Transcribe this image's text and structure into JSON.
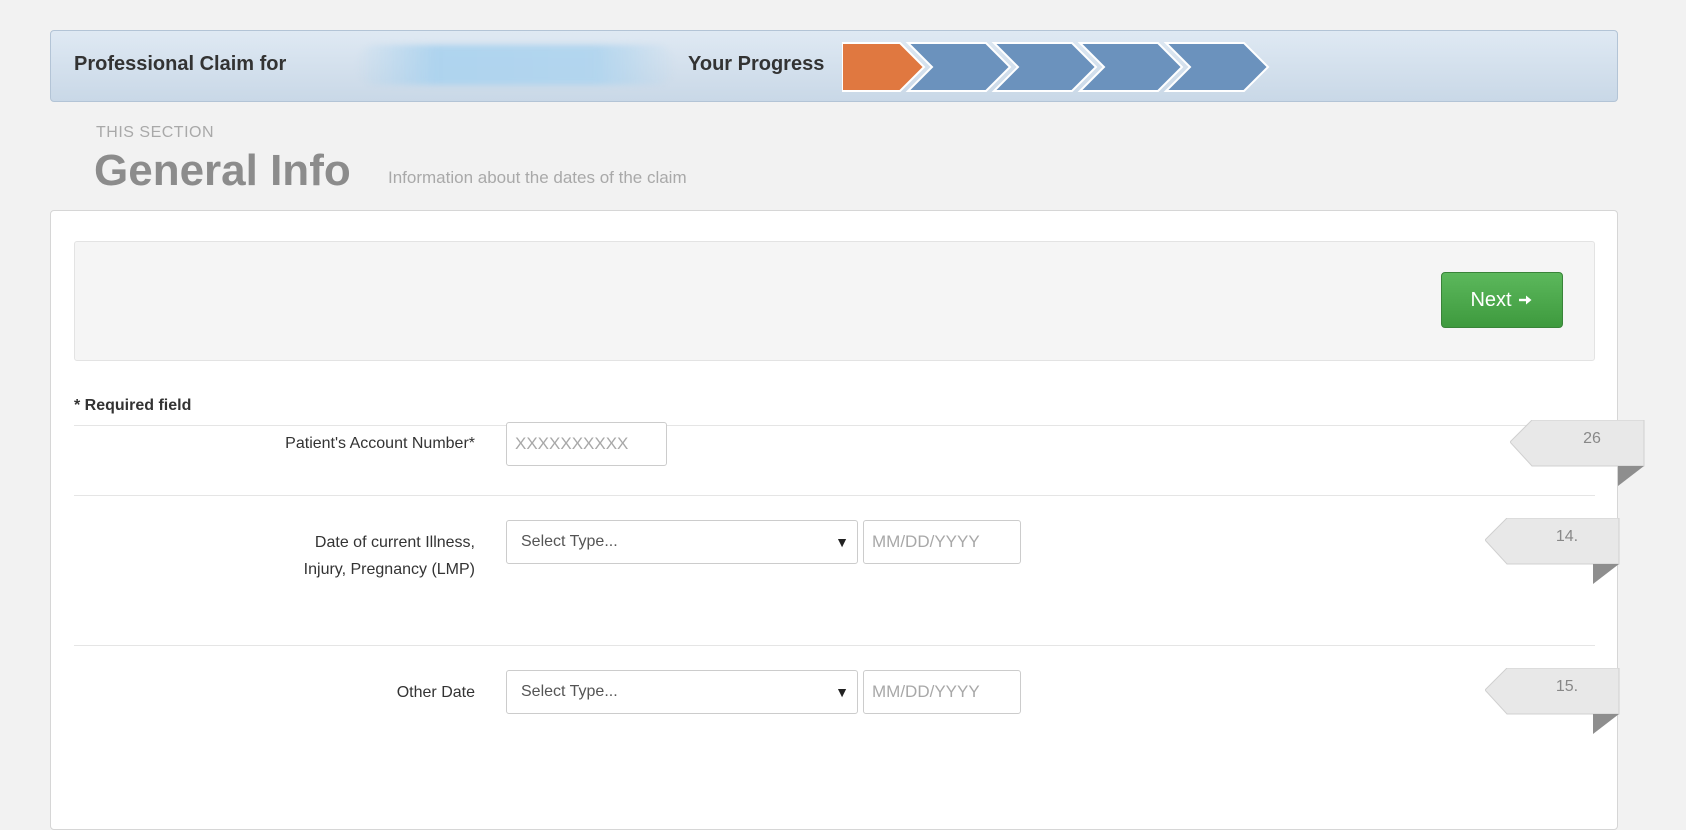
{
  "header": {
    "title": "Professional Claim for",
    "progress_label": "Your Progress",
    "progress": {
      "total_steps": 5,
      "current_step": 1,
      "active_color": "#e07840",
      "inactive_color": "#6b92bd"
    }
  },
  "section": {
    "eyebrow": "THIS SECTION",
    "title": "General Info",
    "subtitle": "Information about the dates of the claim"
  },
  "actions": {
    "next_label": "Next",
    "next_icon": "arrow-right-icon",
    "next_color": "#4cae4c"
  },
  "form": {
    "required_note": "* Required field",
    "account_number": {
      "label": "Patient's Account Number*",
      "placeholder": "XXXXXXXXXX",
      "tag": "26"
    },
    "current_illness": {
      "label_line1": "Date of current Illness,",
      "label_line2": "Injury, Pregnancy (LMP)",
      "select_value": "Select Type...",
      "date_placeholder": "MM/DD/YYYY",
      "tag": "14."
    },
    "other_date": {
      "label": "Other Date",
      "select_value": "Select Type...",
      "date_placeholder": "MM/DD/YYYY",
      "tag": "15."
    }
  }
}
